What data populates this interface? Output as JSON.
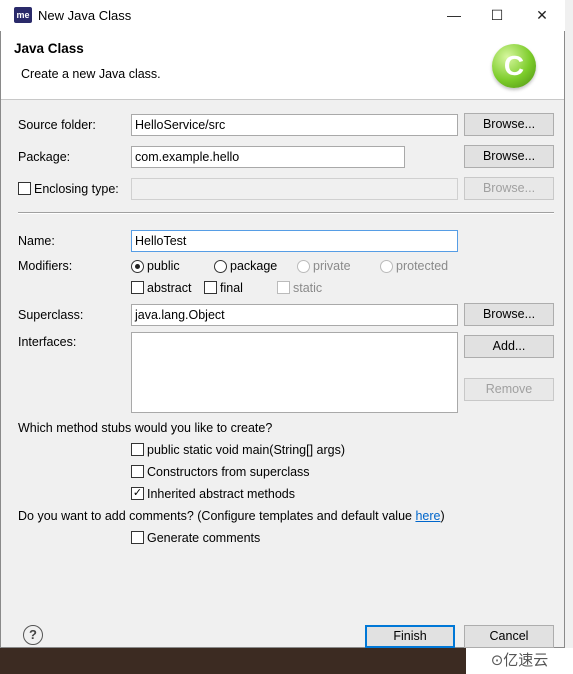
{
  "window": {
    "title": "New Java Class",
    "app_icon_text": "me",
    "minimize": "—",
    "maximize": "☐",
    "close": "✕"
  },
  "header": {
    "title": "Java Class",
    "description": "Create a new Java class.",
    "icon_letter": "C"
  },
  "source_folder": {
    "label": "Source folder:",
    "value": "HelloService/src",
    "button": "Browse..."
  },
  "package": {
    "label": "Package:",
    "value": "com.example.hello",
    "button": "Browse..."
  },
  "enclosing_type": {
    "label": "Enclosing type:",
    "value": "",
    "button": "Browse...",
    "checked": false
  },
  "name": {
    "label": "Name:",
    "value": "HelloTest"
  },
  "modifiers": {
    "label": "Modifiers:",
    "access": [
      "public",
      "package",
      "private",
      "protected"
    ],
    "selected": "public",
    "abstract": "abstract",
    "final": "final",
    "static": "static"
  },
  "superclass": {
    "label": "Superclass:",
    "value": "java.lang.Object",
    "button": "Browse..."
  },
  "interfaces": {
    "label": "Interfaces:",
    "add_button": "Add...",
    "remove_button": "Remove"
  },
  "stubs": {
    "question": "Which method stubs would you like to create?",
    "main": "public static void main(String[] args)",
    "constructors": "Constructors from superclass",
    "inherited": "Inherited abstract methods"
  },
  "comments": {
    "question": "Do you want to add comments? (Configure templates and default value ",
    "link": "here",
    "question_end": ")",
    "generate": "Generate comments"
  },
  "footer": {
    "help": "?",
    "finish": "Finish",
    "cancel": "Cancel"
  },
  "watermark": "⊙亿速云"
}
